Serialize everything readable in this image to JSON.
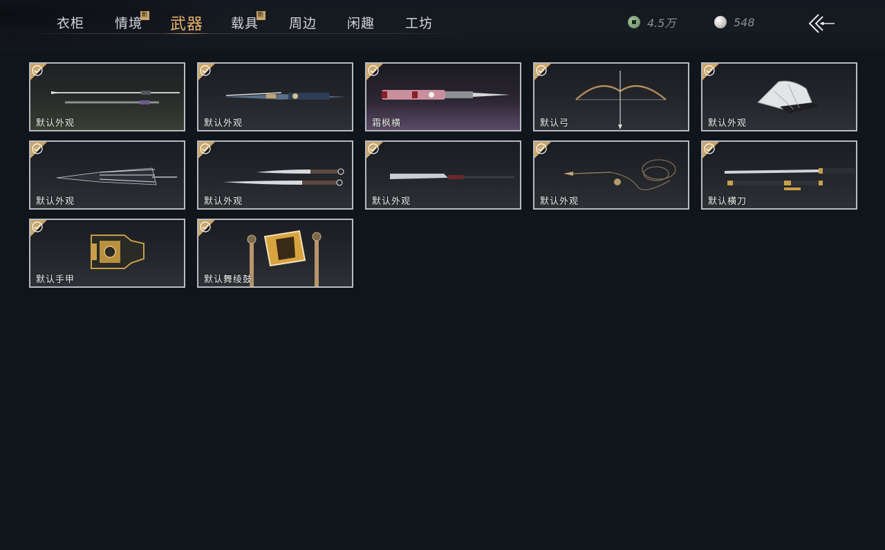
{
  "nav": {
    "tabs": [
      {
        "label": "衣柜",
        "badge": ""
      },
      {
        "label": "情境",
        "badge": "新"
      },
      {
        "label": "武器",
        "badge": ""
      },
      {
        "label": "载具",
        "badge": "新"
      },
      {
        "label": "周边",
        "badge": ""
      },
      {
        "label": "闲趣",
        "badge": ""
      },
      {
        "label": "工坊",
        "badge": ""
      }
    ],
    "active_index": 2
  },
  "currency": {
    "jade": {
      "value": "4.5万",
      "icon": "jade-coin-icon"
    },
    "pearl": {
      "value": "548",
      "icon": "pearl-icon"
    }
  },
  "back_icon": "back-arrow-icon",
  "colors": {
    "accent": "#e8b06a",
    "background": "#10141b",
    "card_border": "#b9bcc1",
    "check_badge": "#c9a56a"
  },
  "items": [
    {
      "label": "默认外观",
      "icon": "spear-icon",
      "owned": true
    },
    {
      "label": "默认外观",
      "icon": "twin-blades-icon",
      "owned": true
    },
    {
      "label": "霜枫横",
      "icon": "sword-sheath-icon",
      "owned": true
    },
    {
      "label": "默认弓",
      "icon": "bow-icon",
      "owned": true
    },
    {
      "label": "默认外观",
      "icon": "fan-icon",
      "owned": true
    },
    {
      "label": "默认外观",
      "icon": "umbrella-icon",
      "owned": true
    },
    {
      "label": "默认外观",
      "icon": "dual-sabers-icon",
      "owned": true
    },
    {
      "label": "默认外观",
      "icon": "long-blade-icon",
      "owned": true
    },
    {
      "label": "默认外观",
      "icon": "rope-dart-icon",
      "owned": true
    },
    {
      "label": "默认横刀",
      "icon": "hengdao-icon",
      "owned": true
    },
    {
      "label": "默认手甲",
      "icon": "gauntlet-icon",
      "owned": true
    },
    {
      "label": "默认舞绫鼓",
      "icon": "drum-icon",
      "owned": true
    }
  ]
}
